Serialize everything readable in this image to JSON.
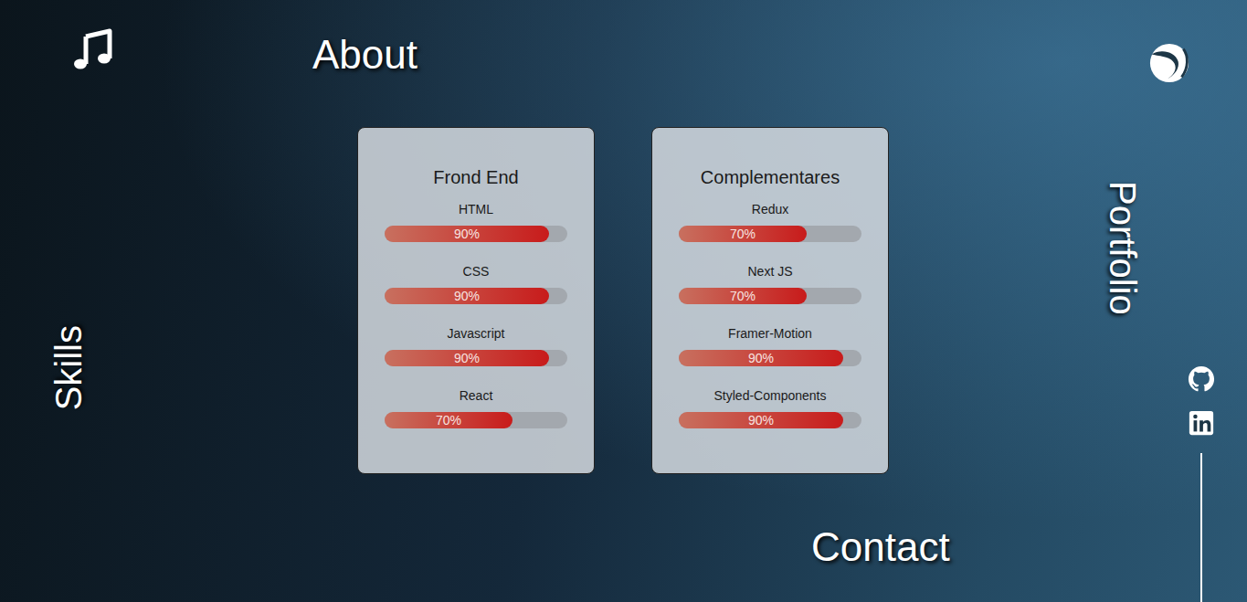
{
  "nav": {
    "about": "About",
    "skills": "Skills",
    "portfolio": "Portfolio",
    "contact": "Contact"
  },
  "cards": [
    {
      "title": "Frond End",
      "skills": [
        {
          "name": "HTML",
          "reading": "90%",
          "level": 0.9
        },
        {
          "name": "CSS",
          "reading": "90%",
          "level": 0.9
        },
        {
          "name": "Javascript",
          "reading": "90%",
          "level": 0.9
        },
        {
          "name": "React",
          "reading": "70%",
          "level": 0.7
        }
      ]
    },
    {
      "title": "Complementares",
      "skills": [
        {
          "name": "Redux",
          "reading": "70%",
          "level": 0.7
        },
        {
          "name": "Next JS",
          "reading": "70%",
          "level": 0.7
        },
        {
          "name": "Framer-Motion",
          "reading": "90%",
          "level": 0.9
        },
        {
          "name": "Styled-Components",
          "reading": "90%",
          "level": 0.9
        }
      ]
    }
  ]
}
